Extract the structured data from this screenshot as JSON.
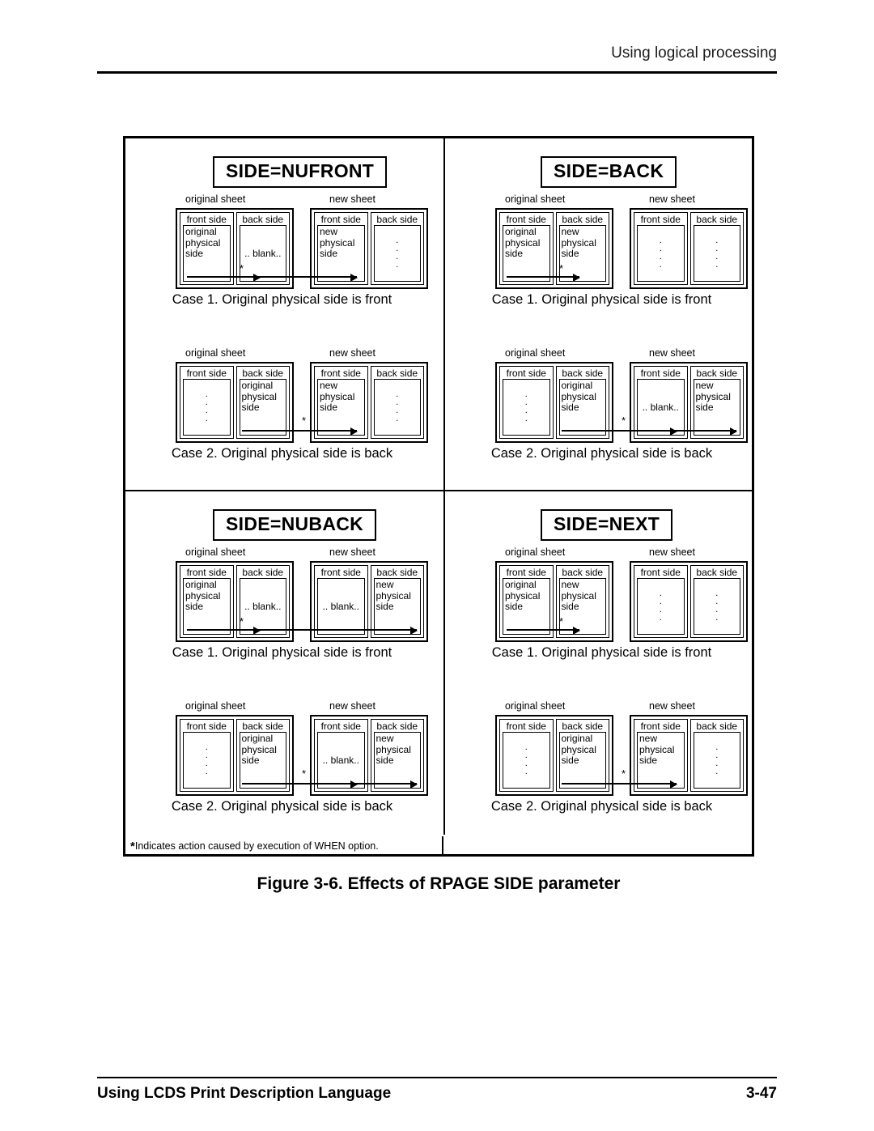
{
  "header": {
    "title": "Using logical processing"
  },
  "footer": {
    "left": "Using LCDS Print Description Language",
    "page": "3-47"
  },
  "figure": {
    "caption": "Figure 3-6. Effects of RPAGE SIDE parameter",
    "footnote_marker": "*",
    "footnote": "Indicates action caused by execution of WHEN option.",
    "labels": {
      "original_sheet": "original sheet",
      "new_sheet": "new sheet",
      "front_side": "front side",
      "back_side": "back side",
      "original_physical_side": "original\nphysical\nside",
      "new_physical_side": "new\nphysical\nside",
      "blank": ".. blank..",
      "case1": "Case 1. Original physical side is front",
      "case2": "Case 2. Original physical side is back"
    },
    "panels": [
      {
        "id": "nufront",
        "title": "SIDE=NUFRONT",
        "cases": [
          {
            "caption": "Case 1. Original physical side is front",
            "original": {
              "front": "original physical side",
              "back": ".. blank.."
            },
            "new": {
              "front": "new physical side",
              "back": "dots"
            },
            "star_at": "original-back",
            "arrows": [
              "original-front-to-back",
              "original-back-to-new-front"
            ]
          },
          {
            "caption": "Case 2. Original physical side is back",
            "original": {
              "front": "dots",
              "back": "original physical side"
            },
            "new": {
              "front": "new physical side",
              "back": "dots"
            },
            "star_at": "between-sheets",
            "arrows": [
              "original-back-to-new-front"
            ]
          }
        ]
      },
      {
        "id": "back",
        "title": "SIDE=BACK",
        "cases": [
          {
            "caption": "Case 1. Original physical side is front",
            "original": {
              "front": "original physical side",
              "back": "new physical side"
            },
            "new": {
              "front": "dots",
              "back": "dots"
            },
            "star_at": "original-back",
            "arrows": [
              "original-front-to-back"
            ]
          },
          {
            "caption": "Case 2. Original physical side is back",
            "original": {
              "front": "dots",
              "back": "original physical side"
            },
            "new": {
              "front": ".. blank..",
              "back": "new physical side"
            },
            "star_at": "between-sheets",
            "arrows": [
              "original-back-to-new-front",
              "new-front-to-new-back"
            ]
          }
        ]
      },
      {
        "id": "nuback",
        "title": "SIDE=NUBACK",
        "cases": [
          {
            "caption": "Case 1. Original physical side is front",
            "original": {
              "front": "original physical side",
              "back": ".. blank.."
            },
            "new": {
              "front": ".. blank..",
              "back": "new physical side"
            },
            "star_at": "original-back",
            "arrows": [
              "original-front-to-back",
              "original-back-to-new-back"
            ]
          },
          {
            "caption": "Case 2. Original physical side is back",
            "original": {
              "front": "dots",
              "back": "original physical side"
            },
            "new": {
              "front": ".. blank..",
              "back": "new physical side"
            },
            "star_at": "between-sheets",
            "arrows": [
              "original-back-to-new-front",
              "new-front-to-new-back"
            ]
          }
        ]
      },
      {
        "id": "next",
        "title": "SIDE=NEXT",
        "cases": [
          {
            "caption": "Case 1. Original physical side is front",
            "original": {
              "front": "original physical side",
              "back": "new physical side"
            },
            "new": {
              "front": "dots",
              "back": "dots"
            },
            "star_at": "original-back",
            "arrows": [
              "original-front-to-back"
            ]
          },
          {
            "caption": "Case 2. Original physical side is back",
            "original": {
              "front": "dots",
              "back": "original physical side"
            },
            "new": {
              "front": "new physical side",
              "back": "dots"
            },
            "star_at": "between-sheets",
            "arrows": [
              "original-back-to-new-front"
            ]
          }
        ]
      }
    ]
  }
}
